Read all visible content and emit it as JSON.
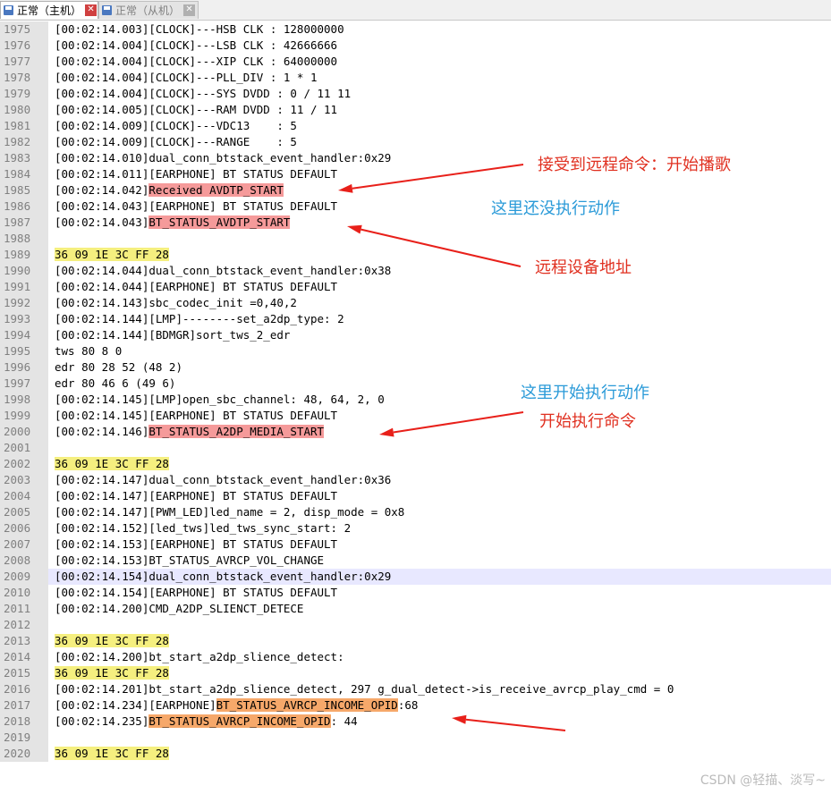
{
  "tabs": [
    {
      "label": "正常（主机）",
      "active": true
    },
    {
      "label": "正常（从机）",
      "active": false
    }
  ],
  "colors": {
    "highlight_red": "#f59a9a",
    "highlight_orange": "#f6a86a",
    "highlight_yellow": "#f5ef7f",
    "note_red": "#e03020",
    "note_blue": "#2a9ad8",
    "arrow": "#e8201a",
    "disk_blue": "#4a78c0",
    "close_red": "#d04040",
    "line_highlight": "#e8e8ff"
  },
  "lines": [
    {
      "n": "1975",
      "t": "[00:02:14.003][CLOCK]---HSB CLK : 128000000"
    },
    {
      "n": "1976",
      "t": "[00:02:14.004][CLOCK]---LSB CLK : 42666666"
    },
    {
      "n": "1977",
      "t": "[00:02:14.004][CLOCK]---XIP CLK : 64000000"
    },
    {
      "n": "1978",
      "t": "[00:02:14.004][CLOCK]---PLL_DIV : 1 * 1"
    },
    {
      "n": "1979",
      "t": "[00:02:14.004][CLOCK]---SYS DVDD : 0 / 11 11"
    },
    {
      "n": "1980",
      "t": "[00:02:14.005][CLOCK]---RAM DVDD : 11 / 11"
    },
    {
      "n": "1981",
      "t": "[00:02:14.009][CLOCK]---VDC13    : 5"
    },
    {
      "n": "1982",
      "t": "[00:02:14.009][CLOCK]---RANGE    : 5"
    },
    {
      "n": "1983",
      "t": "[00:02:14.010]dual_conn_btstack_event_handler:0x29"
    },
    {
      "n": "1984",
      "t": "[00:02:14.011][EARPHONE] BT STATUS DEFAULT"
    },
    {
      "n": "1985",
      "t": "[00:02:14.042]",
      "m": "Received AVDTP_START",
      "c": "red",
      "after": ""
    },
    {
      "n": "1986",
      "t": "[00:02:14.043][EARPHONE] BT STATUS DEFAULT"
    },
    {
      "n": "1987",
      "t": "[00:02:14.043]",
      "m": "BT_STATUS_AVDTP_START",
      "c": "red",
      "after": ""
    },
    {
      "n": "1988",
      "t": ""
    },
    {
      "n": "1989",
      "t": "",
      "m": "36 09 1E 3C FF 28",
      "c": "yellow",
      "after": ""
    },
    {
      "n": "1990",
      "t": "[00:02:14.044]dual_conn_btstack_event_handler:0x38"
    },
    {
      "n": "1991",
      "t": "[00:02:14.044][EARPHONE] BT STATUS DEFAULT"
    },
    {
      "n": "1992",
      "t": "[00:02:14.143]sbc_codec_init =0,40,2"
    },
    {
      "n": "1993",
      "t": "[00:02:14.144][LMP]--------set_a2dp_type: 2"
    },
    {
      "n": "1994",
      "t": "[00:02:14.144][BDMGR]sort_tws_2_edr"
    },
    {
      "n": "1995",
      "t": "tws 80 8 0"
    },
    {
      "n": "1996",
      "t": "edr 80 28 52 (48 2)"
    },
    {
      "n": "1997",
      "t": "edr 80 46 6 (49 6)"
    },
    {
      "n": "1998",
      "t": "[00:02:14.145][LMP]open_sbc_channel: 48, 64, 2, 0"
    },
    {
      "n": "1999",
      "t": "[00:02:14.145][EARPHONE] BT STATUS DEFAULT"
    },
    {
      "n": "2000",
      "t": "[00:02:14.146]",
      "m": "BT_STATUS_A2DP_MEDIA_START",
      "c": "red",
      "after": ""
    },
    {
      "n": "2001",
      "t": ""
    },
    {
      "n": "2002",
      "t": "",
      "m": "36 09 1E 3C FF 28",
      "c": "yellow",
      "after": ""
    },
    {
      "n": "2003",
      "t": "[00:02:14.147]dual_conn_btstack_event_handler:0x36"
    },
    {
      "n": "2004",
      "t": "[00:02:14.147][EARPHONE] BT STATUS DEFAULT"
    },
    {
      "n": "2005",
      "t": "[00:02:14.147][PWM_LED]led_name = 2, disp_mode = 0x8"
    },
    {
      "n": "2006",
      "t": "[00:02:14.152][led_tws]led_tws_sync_start: 2"
    },
    {
      "n": "2007",
      "t": "[00:02:14.153][EARPHONE] BT STATUS DEFAULT"
    },
    {
      "n": "2008",
      "t": "[00:02:14.153]BT_STATUS_AVRCP_VOL_CHANGE"
    },
    {
      "n": "2009",
      "t": "[00:02:14.154]dual_conn_btstack_event_handler:0x29",
      "hl": true
    },
    {
      "n": "2010",
      "t": "[00:02:14.154][EARPHONE] BT STATUS DEFAULT"
    },
    {
      "n": "2011",
      "t": "[00:02:14.200]CMD_A2DP_SLIENCT_DETECE"
    },
    {
      "n": "2012",
      "t": ""
    },
    {
      "n": "2013",
      "t": "",
      "m": "36 09 1E 3C FF 28",
      "c": "yellow",
      "after": ""
    },
    {
      "n": "2014",
      "t": "[00:02:14.200]bt_start_a2dp_slience_detect:"
    },
    {
      "n": "2015",
      "t": "",
      "m": "36 09 1E 3C FF 28",
      "c": "yellow",
      "after": ""
    },
    {
      "n": "2016",
      "t": "[00:02:14.201]bt_start_a2dp_slience_detect, 297 g_dual_detect->is_receive_avrcp_play_cmd = 0"
    },
    {
      "n": "2017",
      "t": "[00:02:14.234][EARPHONE]",
      "m": "BT_STATUS_AVRCP_INCOME_OPID",
      "c": "orange",
      "after": ":68"
    },
    {
      "n": "2018",
      "t": "[00:02:14.235]",
      "m": "BT_STATUS_AVRCP_INCOME_OPID",
      "c": "orange",
      "after": ": 44"
    },
    {
      "n": "2019",
      "t": ""
    },
    {
      "n": "2020",
      "t": "",
      "m": "36 09 1E 3C FF 28",
      "c": "yellow",
      "after": ""
    }
  ],
  "annotations": [
    {
      "name": "note-receive-remote-command",
      "text": "接受到远程命令：开始播歌",
      "color": "red"
    },
    {
      "name": "note-not-yet-executed",
      "text": "这里还没执行动作",
      "color": "blue"
    },
    {
      "name": "note-remote-device-address",
      "text": "远程设备地址",
      "color": "red"
    },
    {
      "name": "note-start-executing",
      "text": "这里开始执行动作",
      "color": "blue"
    },
    {
      "name": "note-start-command",
      "text": "开始执行命令",
      "color": "red"
    }
  ],
  "watermark": "CSDN @轻描、淡写~"
}
